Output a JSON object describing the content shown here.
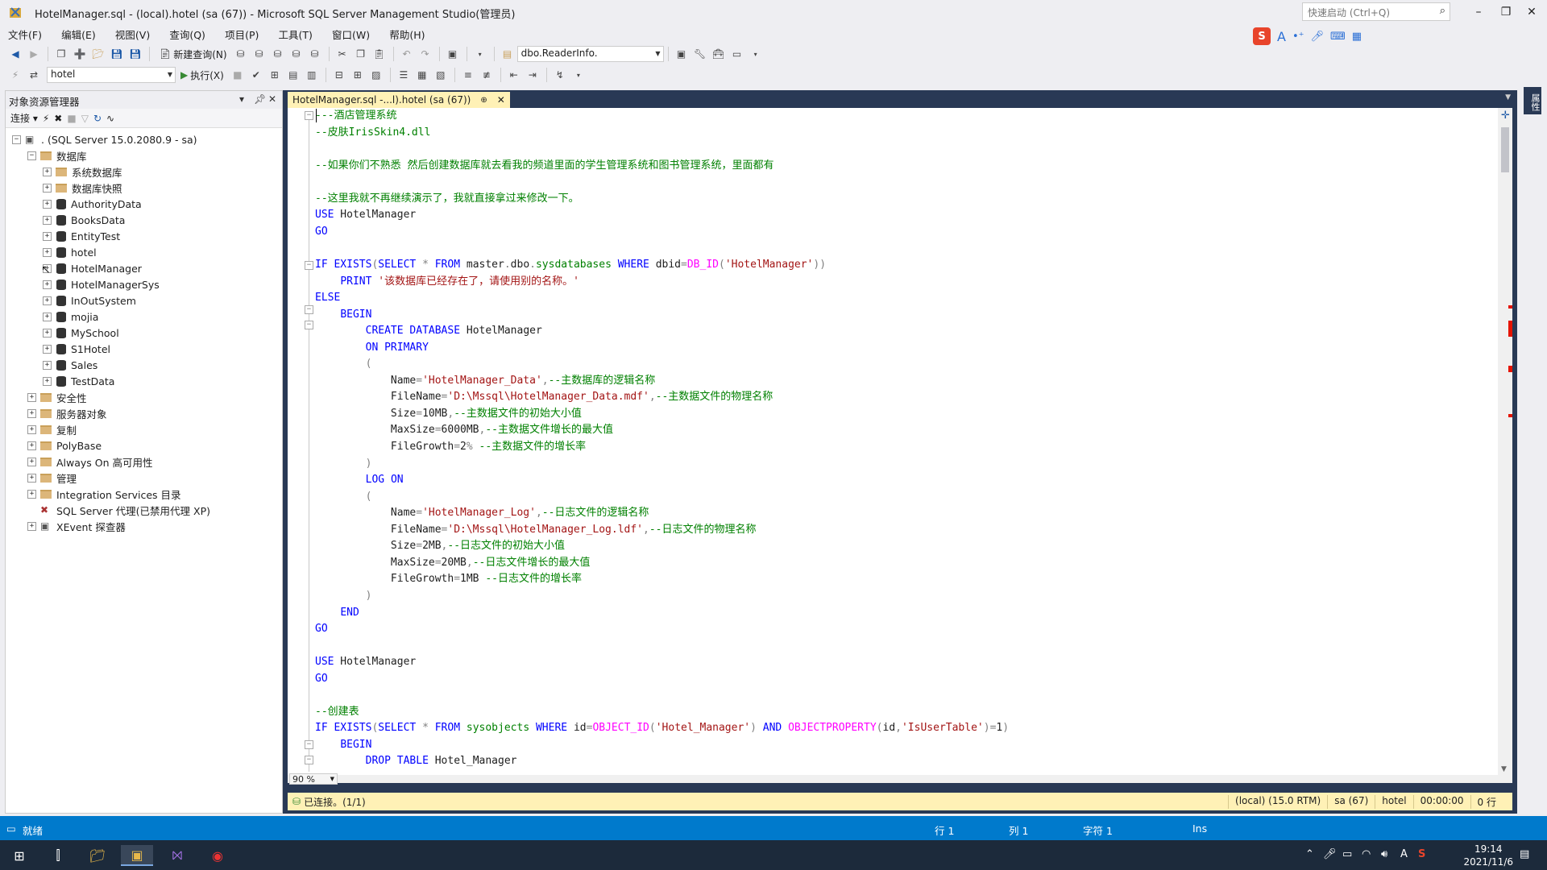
{
  "window": {
    "title": "HotelManager.sql - (local).hotel (sa (67)) - Microsoft SQL Server Management Studio(管理员)",
    "quick_launch_placeholder": "快速启动 (Ctrl+Q)"
  },
  "menu": [
    "文件(F)",
    "编辑(E)",
    "视图(V)",
    "查询(Q)",
    "项目(P)",
    "工具(T)",
    "窗口(W)",
    "帮助(H)"
  ],
  "toolbar": {
    "new_query_label": "新建查询(N)",
    "object_combo_value": "dbo.ReaderInfo.",
    "database_combo_value": "hotel",
    "execute_label": "执行(X)"
  },
  "object_explorer": {
    "title": "对象资源管理器",
    "connect_label": "连接",
    "server_label": ". (SQL Server 15.0.2080.9 - sa)",
    "databases_label": "数据库",
    "db_folders": [
      "系统数据库",
      "数据库快照"
    ],
    "databases": [
      "AuthorityData",
      "BooksData",
      "EntityTest",
      "hotel",
      "HotelManager",
      "HotelManagerSys",
      "InOutSystem",
      "mojia",
      "MySchool",
      "S1Hotel",
      "Sales",
      "TestData"
    ],
    "server_nodes": [
      "安全性",
      "服务器对象",
      "复制",
      "PolyBase",
      "Always On 高可用性",
      "管理",
      "Integration Services 目录"
    ],
    "agent_label": "SQL Server 代理(已禁用代理 XP)",
    "xevent_label": "XEvent 探查器"
  },
  "editor": {
    "tab_label": "HotelManager.sql -...l).hotel (sa (67))",
    "zoom": "90 %",
    "lines": [
      "---酒店管理系统",
      "--皮肤IrisSkin4.dll",
      "",
      "--如果你们不熟悉 然后创建数据库就去看我的频道里面的学生管理系统和图书管理系统，里面都有",
      "",
      "--这里我就不再继续演示了，我就直接拿过来修改一下。",
      "USE HotelManager",
      "GO",
      "",
      "IF EXISTS(SELECT * FROM master.dbo.sysdatabases WHERE dbid=DB_ID('HotelManager'))",
      "    PRINT '该数据库已经存在了，请使用别的名称。'",
      "ELSE",
      "    BEGIN",
      "        CREATE DATABASE HotelManager",
      "        ON PRIMARY",
      "        (",
      "            Name='HotelManager_Data',--主数据库的逻辑名称",
      "            FileName='D:\\Mssql\\HotelManager_Data.mdf',--主数据文件的物理名称",
      "            Size=10MB,--主数据文件的初始大小值",
      "            MaxSize=6000MB,--主数据文件增长的最大值",
      "            FileGrowth=2% --主数据文件的增长率",
      "        )",
      "        LOG ON",
      "        (",
      "            Name='HotelManager_Log',--日志文件的逻辑名称",
      "            FileName='D:\\Mssql\\HotelManager_Log.ldf',--日志文件的物理名称",
      "            Size=2MB,--日志文件的初始大小值",
      "            MaxSize=20MB,--日志文件增长的最大值",
      "            FileGrowth=1MB --日志文件的增长率",
      "        )",
      "    END",
      "GO",
      "",
      "USE HotelManager",
      "GO",
      "",
      "--创建表",
      "IF EXISTS(SELECT * FROM sysobjects WHERE id=OBJECT_ID('Hotel_Manager') AND OBJECTPROPERTY(id,'IsUserTable')=1)",
      "    BEGIN",
      "        DROP TABLE Hotel_Manager"
    ]
  },
  "query_status": {
    "connected": "已连接。(1/1)",
    "server": "(local) (15.0 RTM)",
    "user": "sa (67)",
    "database": "hotel",
    "elapsed": "00:00:00",
    "rows": "0 行"
  },
  "statusbar": {
    "ready": "就绪",
    "line": "行 1",
    "col": "列 1",
    "ch": "字符 1",
    "mode": "Ins"
  },
  "side_tab": "属性",
  "taskbar": {
    "time": "19:14",
    "date": "2021/11/6"
  },
  "colors": {
    "accent": "#007acc",
    "tab_active": "#fff1b6",
    "editor_frame": "#293955",
    "keyword": "#0000ff",
    "comment": "#008000",
    "string": "#a31515"
  }
}
